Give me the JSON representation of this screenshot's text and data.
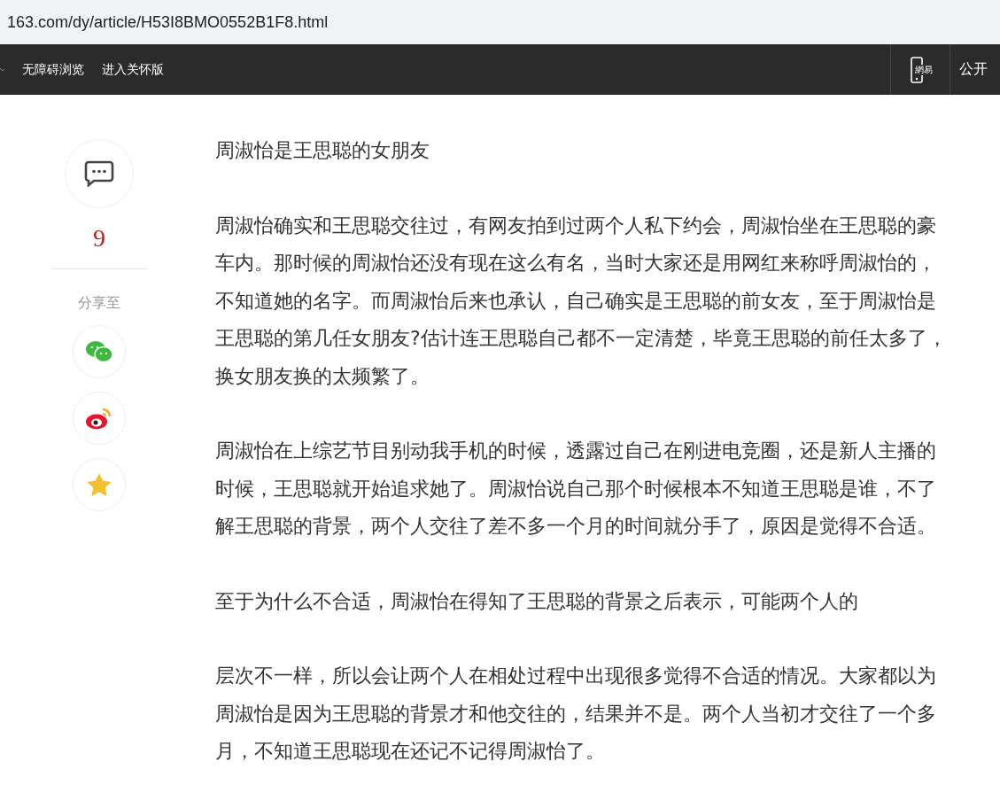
{
  "address_bar": {
    "url": "163.com/dy/article/H53I8BMO0552B1F8.html"
  },
  "top_nav": {
    "links": [
      "无障碍浏览",
      "进入关怀版"
    ],
    "app_logo_text": "網易",
    "right_link": "公开"
  },
  "sidebar": {
    "comment_count": "9",
    "share_label": "分享至",
    "share_targets": [
      {
        "kind": "wechat"
      },
      {
        "kind": "weibo"
      },
      {
        "kind": "qzone"
      }
    ]
  },
  "article": {
    "paragraphs": [
      "周淑怡是王思聪的女朋友",
      "周淑怡确实和王思聪交往过，有网友拍到过两个人私下约会，周淑怡坐在王思聪的豪车内。那时候的周淑怡还没有现在这么有名，当时大家还是用网红来称呼周淑怡的，不知道她的名字。而周淑怡后来也承认，自己确实是王思聪的前女友，至于周淑怡是王思聪的第几任女朋友?估计连王思聪自己都不一定清楚，毕竟王思聪的前任太多了，换女朋友换的太频繁了。",
      "周淑怡在上综艺节目别动我手机的时候，透露过自己在刚进电竞圈，还是新人主播的时候，王思聪就开始追求她了。周淑怡说自己那个时候根本不知道王思聪是谁，不了解王思聪的背景，两个人交往了差不多一个月的时间就分手了，原因是觉得不合适。",
      "至于为什么不合适，周淑怡在得知了王思聪的背景之后表示，可能两个人的",
      "层次不一样，所以会让两个人在相处过程中出现很多觉得不合适的情况。大家都以为周淑怡是因为王思聪的背景才和他交往的，结果并不是。两个人当初才交往了一个多月，不知道王思聪现在还记不记得周淑怡了。"
    ]
  }
}
